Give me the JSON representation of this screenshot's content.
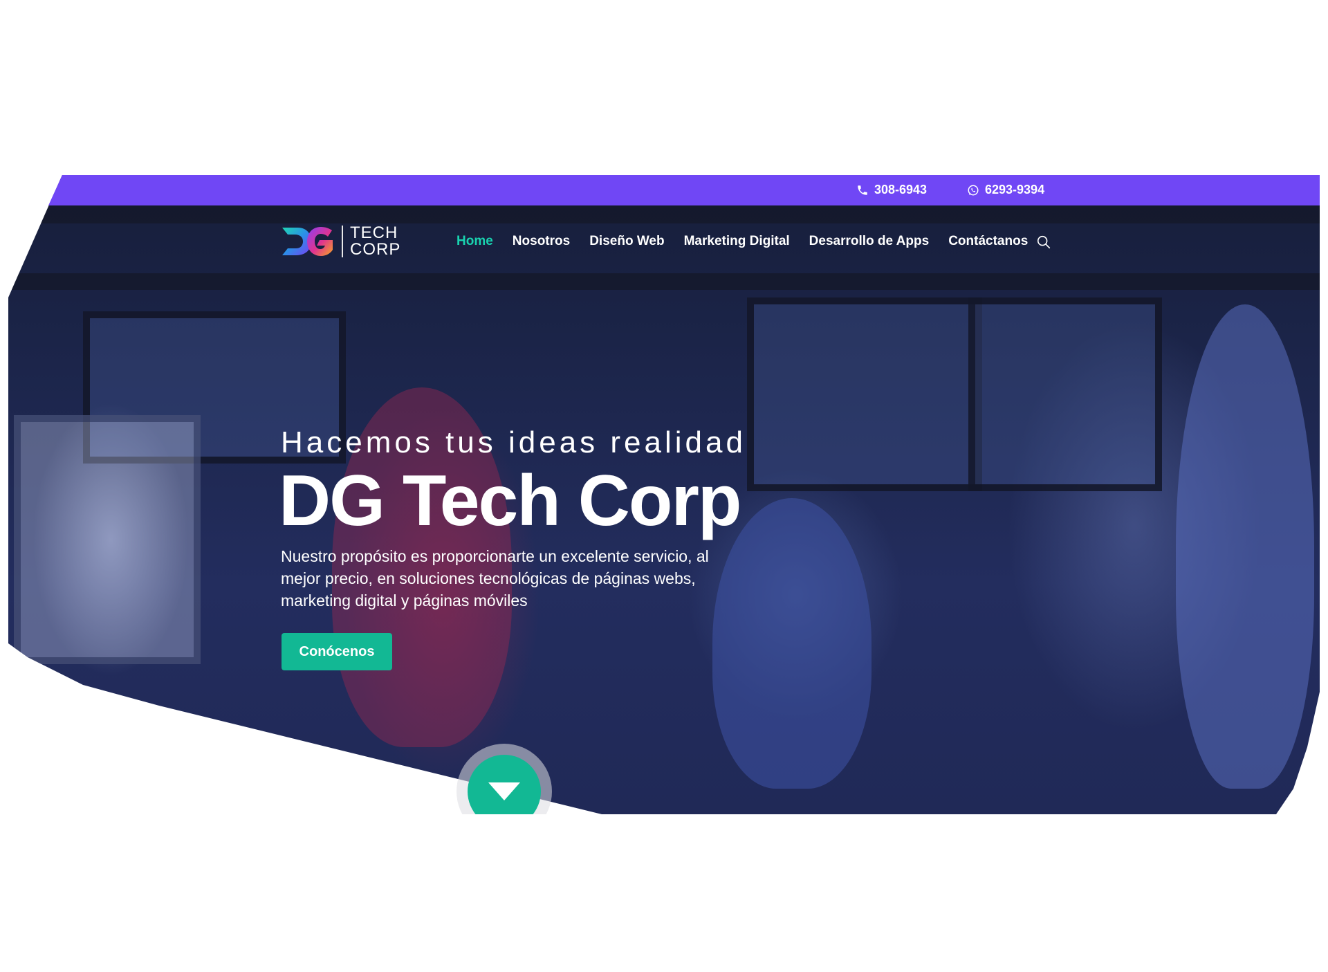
{
  "topbar": {
    "phone": "308-6943",
    "whatsapp": "6293-9394",
    "phone_icon": "phone-icon",
    "whatsapp_icon": "whatsapp-icon",
    "color": "#7047f5"
  },
  "logo": {
    "line1": "TECH",
    "line2": "CORP"
  },
  "nav": {
    "items": [
      {
        "label": "Home",
        "active": true
      },
      {
        "label": "Nosotros"
      },
      {
        "label": "Diseño Web"
      },
      {
        "label": "Marketing Digital"
      },
      {
        "label": "Desarrollo de Apps"
      },
      {
        "label": "Contáctanos"
      }
    ],
    "search_icon": "search-icon",
    "active_color": "#19d3b0"
  },
  "hero": {
    "tagline": "Hacemos tus ideas realidad",
    "title": "DG Tech Corp",
    "description": "Nuestro propósito es proporcionarte un excelente servicio, al mejor precio, en soluciones tecnológicas de páginas webs, marketing digital y páginas móviles",
    "cta_label": "Conócenos",
    "cta_color": "#12b894",
    "scroll_icon": "chevron-down-icon"
  }
}
